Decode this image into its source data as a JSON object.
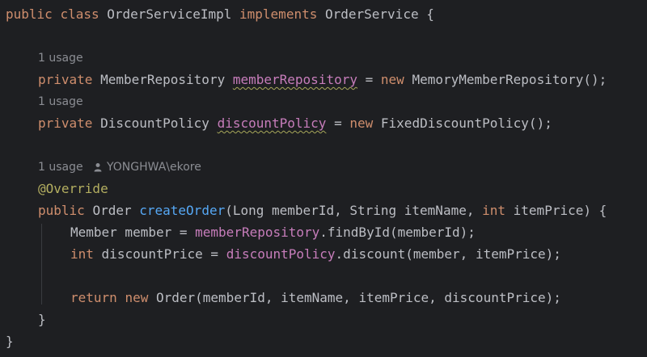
{
  "code": {
    "class_decl": {
      "kw_public": "public",
      "kw_class": "class",
      "class_name": "OrderServiceImpl",
      "kw_implements": "implements",
      "interface_name": "OrderService",
      "brace_open": "{"
    },
    "field1": {
      "usage_hint": "1 usage",
      "kw_private": "private",
      "type": "MemberRepository",
      "name": "memberRepository",
      "equals": "=",
      "kw_new": "new",
      "init": "MemoryMemberRepository();"
    },
    "field2": {
      "usage_hint": "1 usage",
      "kw_private": "private",
      "type": "DiscountPolicy",
      "name": "discountPolicy",
      "equals": "=",
      "kw_new": "new",
      "init": "FixedDiscountPolicy();"
    },
    "method": {
      "usage_hint": "1 usage",
      "author": "YONGHWA\\ekore",
      "annotation": "@Override",
      "kw_public": "public",
      "return_type": "Order",
      "name": "createOrder",
      "params_1": "(Long memberId, String itemName,",
      "kw_int": "int",
      "params_2": "itemPrice) {",
      "stmt1_type": "Member member =",
      "stmt1_field": "memberRepository",
      "stmt1_rest": ".findById(memberId);",
      "stmt2_kw_int": "int",
      "stmt2_left": "discountPrice =",
      "stmt2_field": "discountPolicy",
      "stmt2_rest": ".discount(member, itemPrice);",
      "kw_return": "return",
      "kw_new": "new",
      "return_rest": "Order(memberId, itemName, itemPrice, discountPrice);",
      "brace_close": "}"
    },
    "class_brace_close": "}"
  },
  "colors": {
    "background": "#1e1f22",
    "keyword": "#cf8e6d",
    "field": "#c77dbb",
    "method": "#56a8f5",
    "annotation": "#b3ae60",
    "text": "#bcbec4",
    "hint": "#8b8d93"
  },
  "icons": {
    "author_icon": "person-icon"
  }
}
